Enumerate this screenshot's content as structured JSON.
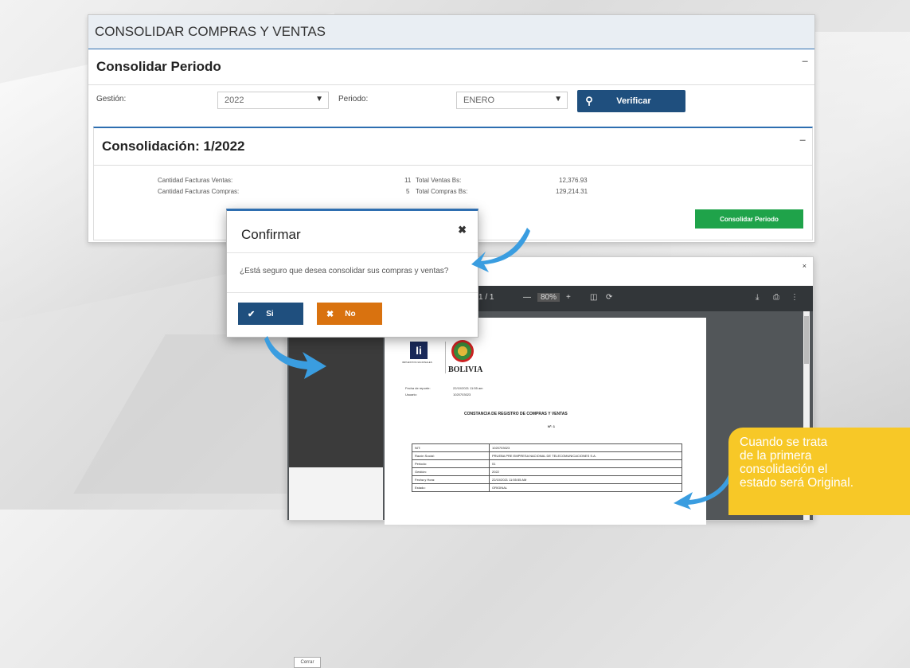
{
  "main": {
    "header_title": "CONSOLIDAR COMPRAS Y VENTAS",
    "section_title": "Consolidar Periodo",
    "collapse_symbol": "–",
    "form": {
      "gestion_label": "Gestión:",
      "gestion_value": "2022",
      "periodo_label": "Periodo:",
      "periodo_value": "ENERO",
      "verify_label": "Verificar"
    },
    "consolidation": {
      "title": "Consolidación: 1/2022",
      "collapse_symbol": "–",
      "rows": [
        {
          "left_label": "Cantidad Facturas Ventas:",
          "count": "11",
          "total_label": "Total Ventas Bs:",
          "total_value": "12,376.93"
        },
        {
          "left_label": "Cantidad Facturas Compras:",
          "count": "5",
          "total_label": "Total Compras Bs:",
          "total_value": "129,214.31"
        }
      ],
      "consolidate_label": "Consolidar Periodo"
    }
  },
  "dialog": {
    "title": "Confirmar",
    "close_symbol": "✖",
    "question": "¿Está seguro que desea consolidar sus compras y ventas?",
    "yes_label": "Si",
    "no_label": "No"
  },
  "pdf_viewer": {
    "close_symbol": "×",
    "page_indicator": "1 / 1",
    "zoom": "80%",
    "cancel_label": "Cerrar",
    "document": {
      "issuer_caption": "IMPUESTOS NACIONALES",
      "country": "BOLIVIA",
      "meta": [
        {
          "label": "Fecha de reporte:",
          "value": "22/10/2021 11:55 am"
        },
        {
          "label": "Usuario:",
          "value": "1020703023"
        }
      ],
      "title": "CONSTANCIA DE REGISTRO DE COMPRAS Y VENTAS",
      "number": "Nº: 1",
      "table": [
        {
          "label": "NIT:",
          "value": "1020703023"
        },
        {
          "label": "Razón Social:",
          "value": "PRUEBA PRE EMPRESA NACIONAL DE TELECOMUNICACIONES S.A."
        },
        {
          "label": "Periodo:",
          "value": "01"
        },
        {
          "label": "Gestión:",
          "value": "2022"
        },
        {
          "label": "Fecha y Hora:",
          "value": "22/10/2021 11:55:55 AM"
        },
        {
          "label": "Estado:",
          "value": "ORIGINAL"
        }
      ]
    }
  },
  "callout": {
    "lines": [
      "Cuando se trata",
      "de la primera",
      "consolidación el",
      "estado será Original."
    ]
  },
  "colors": {
    "primary": "#1f4f7e",
    "success": "#1fa34a",
    "warning": "#d9720f",
    "callout": "#f7c827",
    "arrow": "#3a9de0"
  }
}
